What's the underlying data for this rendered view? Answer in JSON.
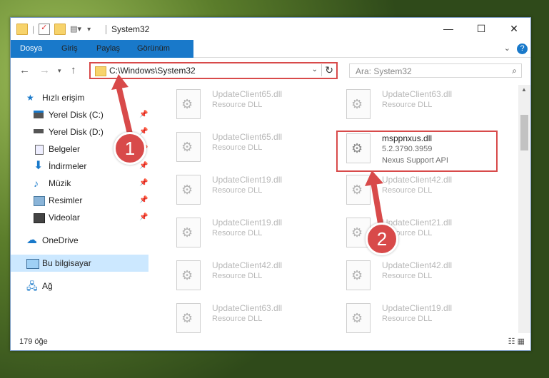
{
  "window": {
    "title": "System32",
    "controls": {
      "minimize": "—",
      "maximize": "☐",
      "close": "✕"
    }
  },
  "ribbon": {
    "tabs": [
      "Dosya",
      "Giriş",
      "Paylaş",
      "Görünüm"
    ],
    "help_icon": "?"
  },
  "address": {
    "path": "C:\\Windows\\System32",
    "search_placeholder": "Ara: System32"
  },
  "nav": {
    "items": [
      {
        "label": "Hızlı erişim",
        "icon": "star-icon"
      },
      {
        "label": "Yerel Disk (C:)",
        "icon": "drive-icon",
        "pinned": true
      },
      {
        "label": "Yerel Disk (D:)",
        "icon": "drive-icon",
        "pinned": true
      },
      {
        "label": "Belgeler",
        "icon": "documents-icon",
        "pinned": true
      },
      {
        "label": "İndirmeler",
        "icon": "download-icon",
        "pinned": true
      },
      {
        "label": "Müzik",
        "icon": "music-icon",
        "pinned": true
      },
      {
        "label": "Resimler",
        "icon": "pictures-icon",
        "pinned": true
      },
      {
        "label": "Videolar",
        "icon": "videos-icon",
        "pinned": true
      },
      {
        "label": "OneDrive",
        "icon": "cloud-icon"
      },
      {
        "label": "Bu bilgisayar",
        "icon": "computer-icon",
        "selected": true
      },
      {
        "label": "Ağ",
        "icon": "network-icon"
      }
    ]
  },
  "files": {
    "left": [
      {
        "name": "UpdateClient65.dll",
        "desc": "Resource DLL"
      },
      {
        "name": "UpdateClient65.dll",
        "desc": "Resource DLL"
      },
      {
        "name": "UpdateClient19.dll",
        "desc": "Resource DLL"
      },
      {
        "name": "UpdateClient19.dll",
        "desc": "Resource DLL"
      },
      {
        "name": "UpdateClient42.dll",
        "desc": "Resource DLL"
      },
      {
        "name": "UpdateClient63.dll",
        "desc": "Resource DLL"
      }
    ],
    "right": [
      {
        "name": "UpdateClient63.dll",
        "desc": "Resource DLL"
      },
      {
        "name": "UpdateClient42.dll",
        "desc": "Resource DLL"
      },
      {
        "name": "UpdateClient21.dll",
        "desc": "Resource DLL"
      },
      {
        "name": "UpdateClient42.dll",
        "desc": "Resource DLL"
      },
      {
        "name": "UpdateClient19.dll",
        "desc": "Resource DLL"
      }
    ],
    "highlighted": {
      "name": "msppnxus.dll",
      "version": "5.2.3790.3959",
      "desc": "Nexus Support API"
    }
  },
  "status": {
    "count": "179 öğe"
  },
  "annotations": {
    "badge1": "1",
    "badge2": "2",
    "accent": "#d84a4a"
  }
}
